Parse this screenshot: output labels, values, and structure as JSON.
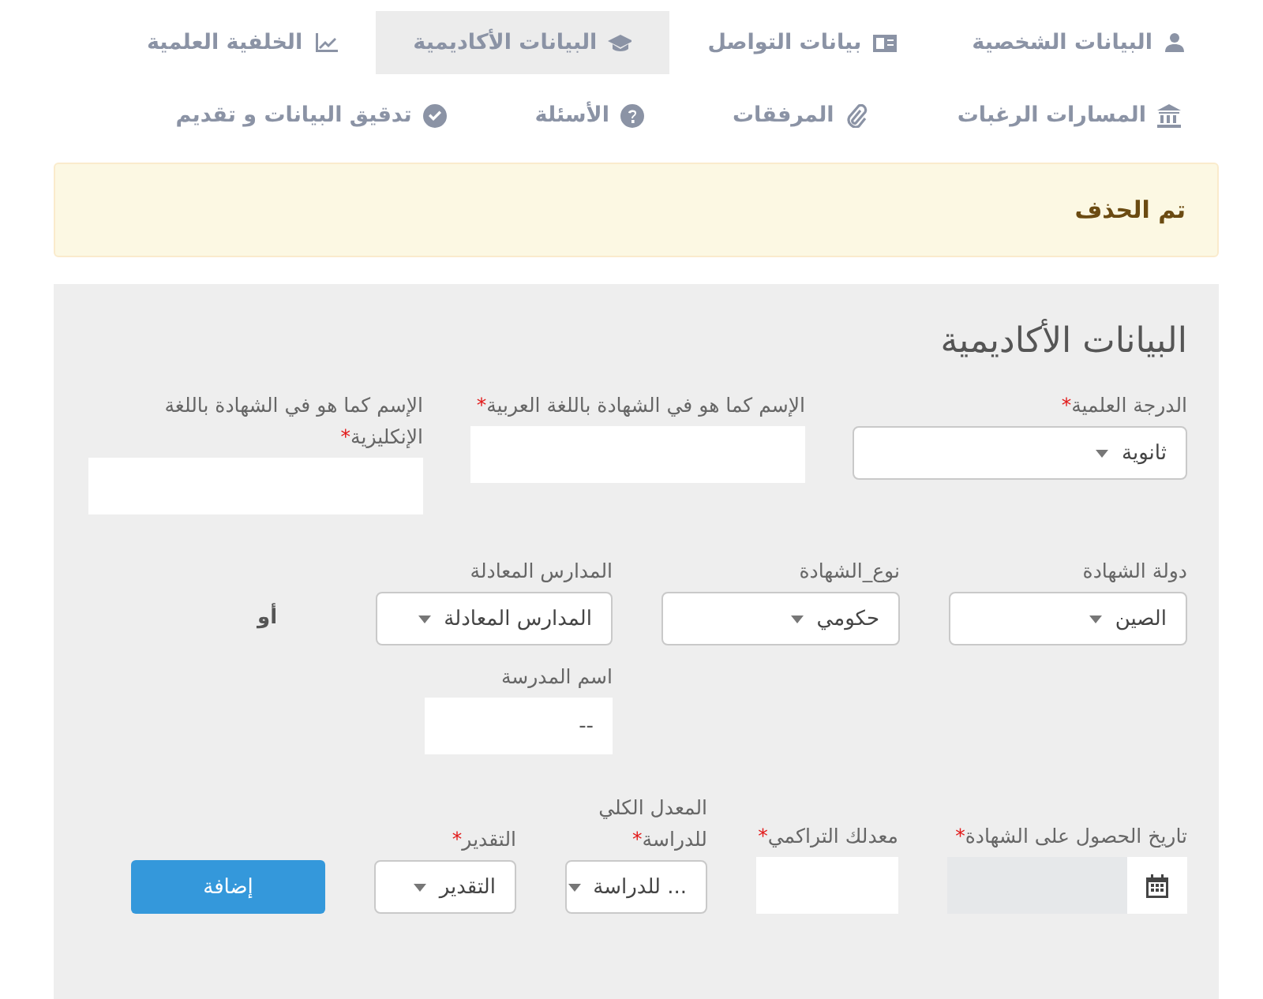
{
  "tabs": [
    [
      {
        "label": "البيانات الشخصية",
        "selected": false
      },
      {
        "label": "بيانات التواصل",
        "selected": false
      },
      {
        "label": "البيانات الأكاديمية",
        "selected": true
      },
      {
        "label": "الخلفية العلمية",
        "selected": false
      }
    ],
    [
      {
        "label": "المسارات الرغبات",
        "selected": false
      },
      {
        "label": "المرفقات",
        "selected": false
      },
      {
        "label": "الأسئلة",
        "selected": false
      },
      {
        "label": "تدقيق البيانات و تقديم",
        "selected": false
      }
    ]
  ],
  "alert": {
    "text": "تم الحذف"
  },
  "section": {
    "title": "البيانات الأكاديمية",
    "rows": [
      {
        "fields": [
          {
            "kind": "select",
            "label": "الدرجة العلمية",
            "required_mark": "*",
            "value": "ثانوية"
          },
          {
            "kind": "text",
            "label": "الإسم كما هو في الشهادة باللغة العربية",
            "required_mark": "*"
          },
          {
            "kind": "text",
            "label": "الإسم كما هو في الشهادة باللغة الإنكليزية",
            "required_mark": "*"
          }
        ]
      },
      {
        "fields": [
          {
            "kind": "select",
            "label": "دولة الشهادة",
            "value": "الصين"
          },
          {
            "kind": "select",
            "label": "نوع_الشهادة",
            "value": "حكومي"
          },
          {
            "kind": "select",
            "label": "المدارس المعادلة",
            "value": "المدارس المعادلة"
          },
          {
            "kind": "separator",
            "text": "أو"
          }
        ]
      },
      {
        "fields": [
          {
            "kind": "text",
            "label": "اسم المدرسة",
            "placeholder": "--"
          }
        ]
      },
      {
        "fields": [
          {
            "kind": "date",
            "label": "تاريخ الحصول على الشهادة",
            "required_mark": "*",
            "disabled": true
          },
          {
            "kind": "text",
            "label": "معدلك التراكمي",
            "required_mark": "*"
          },
          {
            "kind": "select",
            "label": "المعدل الكلي للدراسة",
            "required_mark": "*",
            "value": "... للدراسة"
          },
          {
            "kind": "select",
            "label": "التقدير",
            "required_mark": "*",
            "value": "التقدير"
          },
          {
            "kind": "button",
            "label": "إضافة"
          }
        ]
      }
    ]
  }
}
